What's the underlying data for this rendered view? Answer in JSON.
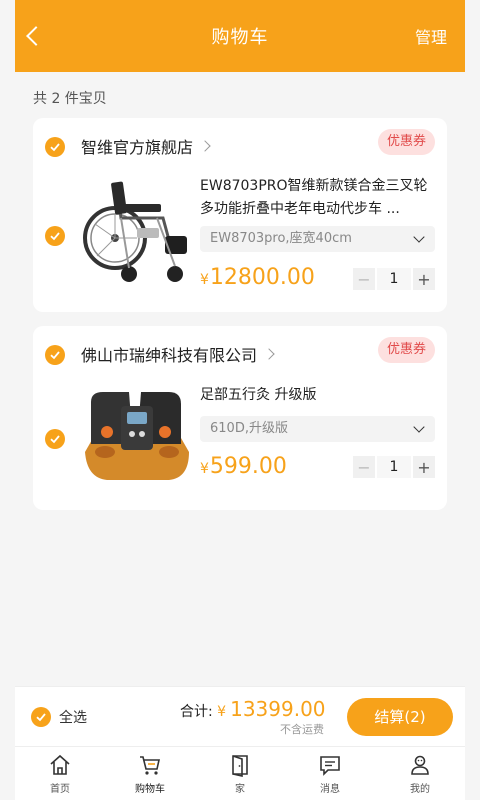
{
  "header": {
    "title": "购物车",
    "manage_label": "管理"
  },
  "summary": {
    "count_text": "共 2 件宝贝"
  },
  "stores": [
    {
      "name": "智维官方旗舰店",
      "coupon_label": "优惠券",
      "item": {
        "name": "EW8703PRO智维新款镁合金三叉轮多功能折叠中老年电动代步车 ...",
        "spec": "EW8703pro,座宽40cm",
        "price_symbol": "¥",
        "price": "12800.00",
        "qty": "1",
        "image": "wheelchair"
      }
    },
    {
      "name": "佛山市瑞绅科技有限公司",
      "coupon_label": "优惠券",
      "item": {
        "name": "足部五行灸 升级版",
        "spec": "610D,升级版",
        "price_symbol": "¥",
        "price": "599.00",
        "qty": "1",
        "image": "foot-massager"
      }
    }
  ],
  "footer": {
    "select_all_label": "全选",
    "total_label": "合计:",
    "total_symbol": "¥",
    "total_amount": "13399.00",
    "shipping_note": "不含运费",
    "checkout_label": "结算(2)"
  },
  "tabbar": [
    {
      "label": "首页",
      "icon": "home-icon"
    },
    {
      "label": "购物车",
      "icon": "cart-icon",
      "active": true
    },
    {
      "label": "家",
      "icon": "door-icon"
    },
    {
      "label": "消息",
      "icon": "message-icon"
    },
    {
      "label": "我的",
      "icon": "profile-icon"
    }
  ],
  "colors": {
    "accent": "#f7a21a",
    "coupon_bg": "#fde0df",
    "coupon_text": "#e14a4a",
    "background": "#f5f5f5"
  }
}
